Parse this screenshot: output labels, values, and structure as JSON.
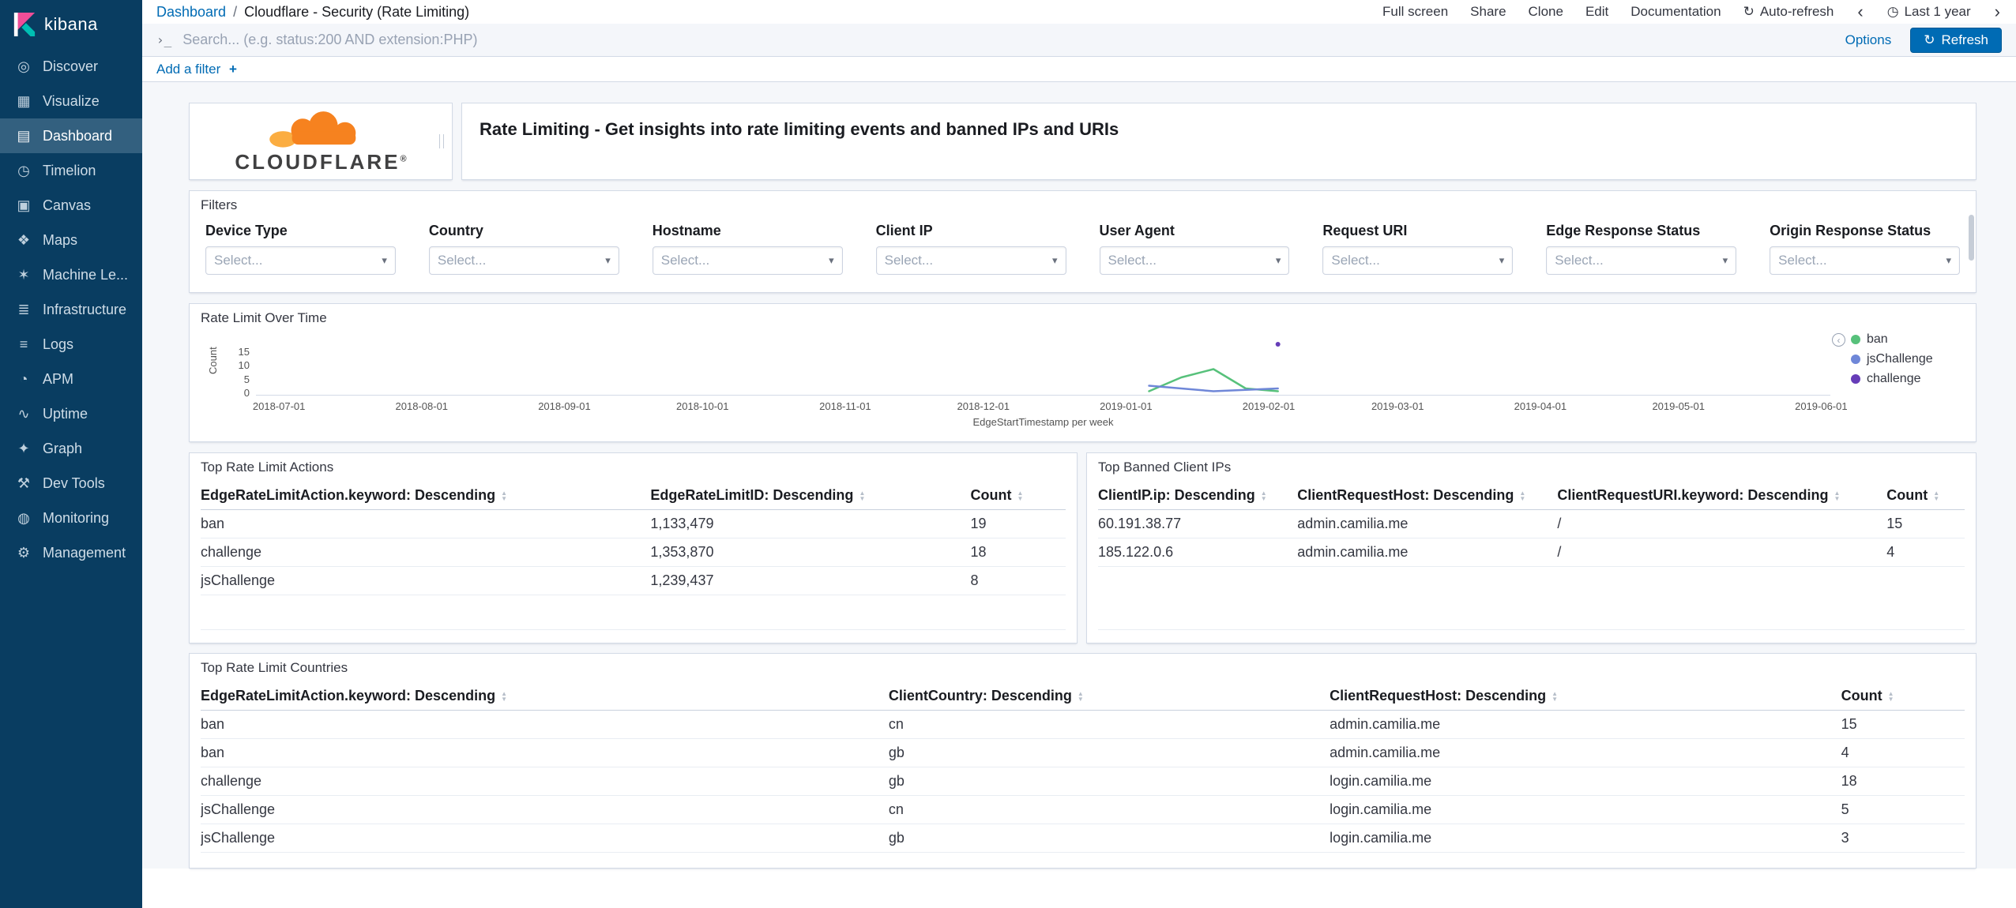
{
  "colors": {
    "link_blue": "#006bb4",
    "sidebar_navy": "#093d61",
    "cloudflare_orange": "#f6821f",
    "cloudflare_orange_light": "#fbad41"
  },
  "sidebar": {
    "brand": "kibana",
    "items": [
      {
        "label": "Discover",
        "icon": "discover-compass-icon",
        "glyph": "◎",
        "active": false
      },
      {
        "label": "Visualize",
        "icon": "visualize-chart-icon",
        "glyph": "▦",
        "active": false
      },
      {
        "label": "Dashboard",
        "icon": "dashboard-grid-icon",
        "glyph": "▤",
        "active": true
      },
      {
        "label": "Timelion",
        "icon": "timelion-clock-icon",
        "glyph": "◷",
        "active": false
      },
      {
        "label": "Canvas",
        "icon": "canvas-easel-icon",
        "glyph": "▣",
        "active": false
      },
      {
        "label": "Maps",
        "icon": "maps-pin-icon",
        "glyph": "❖",
        "active": false
      },
      {
        "label": "Machine Le...",
        "icon": "machine-learning-icon",
        "glyph": "✶",
        "active": false
      },
      {
        "label": "Infrastructure",
        "icon": "infrastructure-stack-icon",
        "glyph": "≣",
        "active": false
      },
      {
        "label": "Logs",
        "icon": "logs-lines-icon",
        "glyph": "≡",
        "active": false
      },
      {
        "label": "APM",
        "icon": "apm-gauge-icon",
        "glyph": "◔",
        "active": false
      },
      {
        "label": "Uptime",
        "icon": "uptime-pulse-icon",
        "glyph": "∿",
        "active": false
      },
      {
        "label": "Graph",
        "icon": "graph-nodes-icon",
        "glyph": "✦",
        "active": false
      },
      {
        "label": "Dev Tools",
        "icon": "dev-tools-wrench-icon",
        "glyph": "⚒",
        "active": false
      },
      {
        "label": "Monitoring",
        "icon": "monitoring-icon",
        "glyph": "◍",
        "active": false
      },
      {
        "label": "Management",
        "icon": "management-gear-icon",
        "glyph": "⚙",
        "active": false
      }
    ]
  },
  "breadcrumb": {
    "root": "Dashboard",
    "separator": "/",
    "current": "Cloudflare - Security (Rate Limiting)"
  },
  "header": {
    "actions": [
      "Full screen",
      "Share",
      "Clone",
      "Edit",
      "Documentation"
    ],
    "auto_refresh": {
      "glyph": "↻",
      "label": "Auto-refresh"
    },
    "time_picker": {
      "prev_glyph": "‹",
      "clock_glyph": "◷",
      "label": "Last 1 year",
      "next_glyph": "›"
    }
  },
  "query_bar": {
    "prompt_glyph": "›_",
    "placeholder": "Search... (e.g. status:200 AND extension:PHP)",
    "options_label": "Options",
    "refresh": {
      "glyph": "↻",
      "label": "Refresh"
    }
  },
  "filter_bar": {
    "add_label": "Add a filter",
    "plus_glyph": "+"
  },
  "panels": {
    "logo": {
      "brand": "CLOUDFLARE",
      "registered": "®",
      "cloud_color": "#f6821f",
      "cloud_color_light": "#fbad41"
    },
    "markdown": {
      "text": "Rate Limiting - Get insights into rate limiting events and banned IPs and URIs"
    },
    "filters": {
      "title": "Filters",
      "placeholder": "Select...",
      "chevron_glyph": "▾",
      "fields": [
        "Device Type",
        "Country",
        "Hostname",
        "Client IP",
        "User Agent",
        "Request URI",
        "Edge Response Status",
        "Origin Response Status"
      ]
    }
  },
  "chart_data": {
    "type": "line",
    "title": "Rate Limit Over Time",
    "xlabel": "EdgeStartTimestamp per week",
    "ylabel": "Count",
    "legend_position": "right",
    "grid": false,
    "x_domain": [
      "2018-06-26",
      "2019-06-03"
    ],
    "ylim": [
      0,
      20
    ],
    "y_ticks": [
      15,
      10,
      5,
      0
    ],
    "x_ticks": [
      "2018-07-01",
      "2018-08-01",
      "2018-09-01",
      "2018-10-01",
      "2018-11-01",
      "2018-12-01",
      "2019-01-01",
      "2019-02-01",
      "2019-03-01",
      "2019-04-01",
      "2019-05-01",
      "2019-06-01"
    ],
    "series": [
      {
        "name": "ban",
        "color": "#57c17b",
        "points": [
          [
            "2019-01-06",
            1
          ],
          [
            "2019-01-13",
            6
          ],
          [
            "2019-01-20",
            9
          ],
          [
            "2019-01-27",
            2
          ],
          [
            "2019-02-03",
            1
          ]
        ]
      },
      {
        "name": "jsChallenge",
        "color": "#6f87d8",
        "points": [
          [
            "2019-01-06",
            3
          ],
          [
            "2019-01-13",
            2
          ],
          [
            "2019-01-20",
            1
          ],
          [
            "2019-02-03",
            2
          ]
        ]
      },
      {
        "name": "challenge",
        "color": "#663db8",
        "points": [
          [
            "2019-02-03",
            18
          ]
        ]
      }
    ]
  },
  "tables": {
    "sort_glyphs": {
      "up": "▲",
      "down": "▼"
    },
    "actions": {
      "title": "Top Rate Limit Actions",
      "columns": [
        "EdgeRateLimitAction.keyword: Descending",
        "EdgeRateLimitID: Descending",
        "Count"
      ],
      "col_widths": [
        "52%",
        "37%",
        "11%"
      ],
      "rows": [
        [
          "ban",
          "1,133,479",
          "19"
        ],
        [
          "challenge",
          "1,353,870",
          "18"
        ],
        [
          "jsChallenge",
          "1,239,437",
          "8"
        ]
      ]
    },
    "banned": {
      "title": "Top Banned Client IPs",
      "columns": [
        "ClientIP.ip: Descending",
        "ClientRequestHost: Descending",
        "ClientRequestURI.keyword: Descending",
        "Count"
      ],
      "col_widths": [
        "23%",
        "30%",
        "38%",
        "9%"
      ],
      "rows": [
        [
          "60.191.38.77",
          "admin.camilia.me",
          "/",
          "15"
        ],
        [
          "185.122.0.6",
          "admin.camilia.me",
          "/",
          "4"
        ]
      ]
    },
    "countries": {
      "title": "Top Rate Limit Countries",
      "columns": [
        "EdgeRateLimitAction.keyword: Descending",
        "ClientCountry: Descending",
        "ClientRequestHost: Descending",
        "Count"
      ],
      "col_widths": [
        "39%",
        "25%",
        "29%",
        "7%"
      ],
      "rows": [
        [
          "ban",
          "cn",
          "admin.camilia.me",
          "15"
        ],
        [
          "ban",
          "gb",
          "admin.camilia.me",
          "4"
        ],
        [
          "challenge",
          "gb",
          "login.camilia.me",
          "18"
        ],
        [
          "jsChallenge",
          "cn",
          "login.camilia.me",
          "5"
        ],
        [
          "jsChallenge",
          "gb",
          "login.camilia.me",
          "3"
        ]
      ]
    }
  }
}
